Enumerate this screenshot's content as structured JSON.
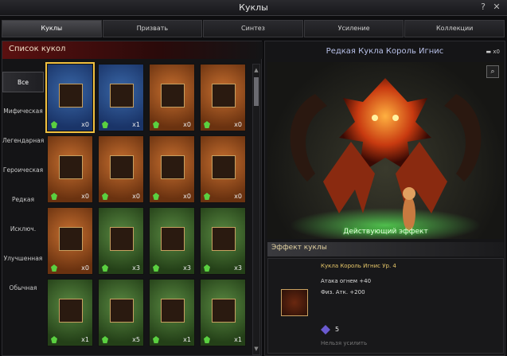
{
  "window": {
    "title": "Куклы",
    "help_label": "?",
    "close_label": "✕"
  },
  "tabs": [
    {
      "label": "Куклы",
      "active": true
    },
    {
      "label": "Призвать",
      "active": false
    },
    {
      "label": "Синтез",
      "active": false
    },
    {
      "label": "Усиление",
      "active": false
    },
    {
      "label": "Коллекции",
      "active": false
    }
  ],
  "list": {
    "header": "Список кукол",
    "filters": [
      {
        "label": "Все",
        "active": true
      },
      {
        "label": "Мифическая",
        "active": false
      },
      {
        "label": "Легендарная",
        "active": false
      },
      {
        "label": "Героическая",
        "active": false
      },
      {
        "label": "Редкая",
        "active": false
      },
      {
        "label": "Исключ.",
        "active": false
      },
      {
        "label": "Улучшенная",
        "active": false
      },
      {
        "label": "Обычная",
        "active": false
      }
    ],
    "cards": [
      {
        "color": "blue",
        "count": "x0",
        "selected": true,
        "icon": "fire-demon-portrait"
      },
      {
        "color": "blue",
        "count": "x1",
        "selected": false,
        "icon": "white-haired-portrait"
      },
      {
        "color": "orange",
        "count": "x0",
        "selected": false,
        "icon": "armored-beast-portrait"
      },
      {
        "color": "orange",
        "count": "x0",
        "selected": false,
        "icon": "red-warrior-portrait"
      },
      {
        "color": "orange",
        "count": "x0",
        "selected": false,
        "icon": "masked-girl-portrait"
      },
      {
        "color": "orange",
        "count": "x0",
        "selected": false,
        "icon": "goblin-portrait"
      },
      {
        "color": "orange",
        "count": "x0",
        "selected": false,
        "icon": "crystal-orb-portrait"
      },
      {
        "color": "orange",
        "count": "x0",
        "selected": false,
        "icon": "witch-portrait"
      },
      {
        "color": "orange",
        "count": "x0",
        "selected": false,
        "icon": "dark-elf-portrait"
      },
      {
        "color": "green",
        "count": "x3",
        "selected": false,
        "icon": "frog-portrait"
      },
      {
        "color": "green",
        "count": "x3",
        "selected": false,
        "icon": "ice-mage-portrait"
      },
      {
        "color": "green",
        "count": "x3",
        "selected": false,
        "icon": "jester-portrait"
      },
      {
        "color": "green",
        "count": "x1",
        "selected": false,
        "icon": "red-knight-portrait"
      },
      {
        "color": "green",
        "count": "x5",
        "selected": false,
        "icon": "skeleton-portrait"
      },
      {
        "color": "green",
        "count": "x1",
        "selected": false,
        "icon": "blue-hair-portrait"
      },
      {
        "color": "green",
        "count": "x1",
        "selected": false,
        "icon": "lion-portrait"
      }
    ]
  },
  "detail": {
    "title": "Редкая Кукла Король Игнис",
    "owned_count": "x0",
    "zoom_icon": "magnifier-icon",
    "preview_effect_label": "Действующий эффект",
    "effect_header": "Эффект куклы",
    "effect_name": "Кукла Король Игнис Ур. 4",
    "effect_stats": [
      "Атака огнем +40",
      "Физ. Атк. +200"
    ],
    "upgrade_value": "5",
    "upgrade_status": "Нельзя усилить"
  },
  "colors": {
    "accent_gold": "#f0c040",
    "title_blue": "#b8c0e8",
    "effect_green": "#40ff40",
    "header_red": "#5a1010"
  }
}
